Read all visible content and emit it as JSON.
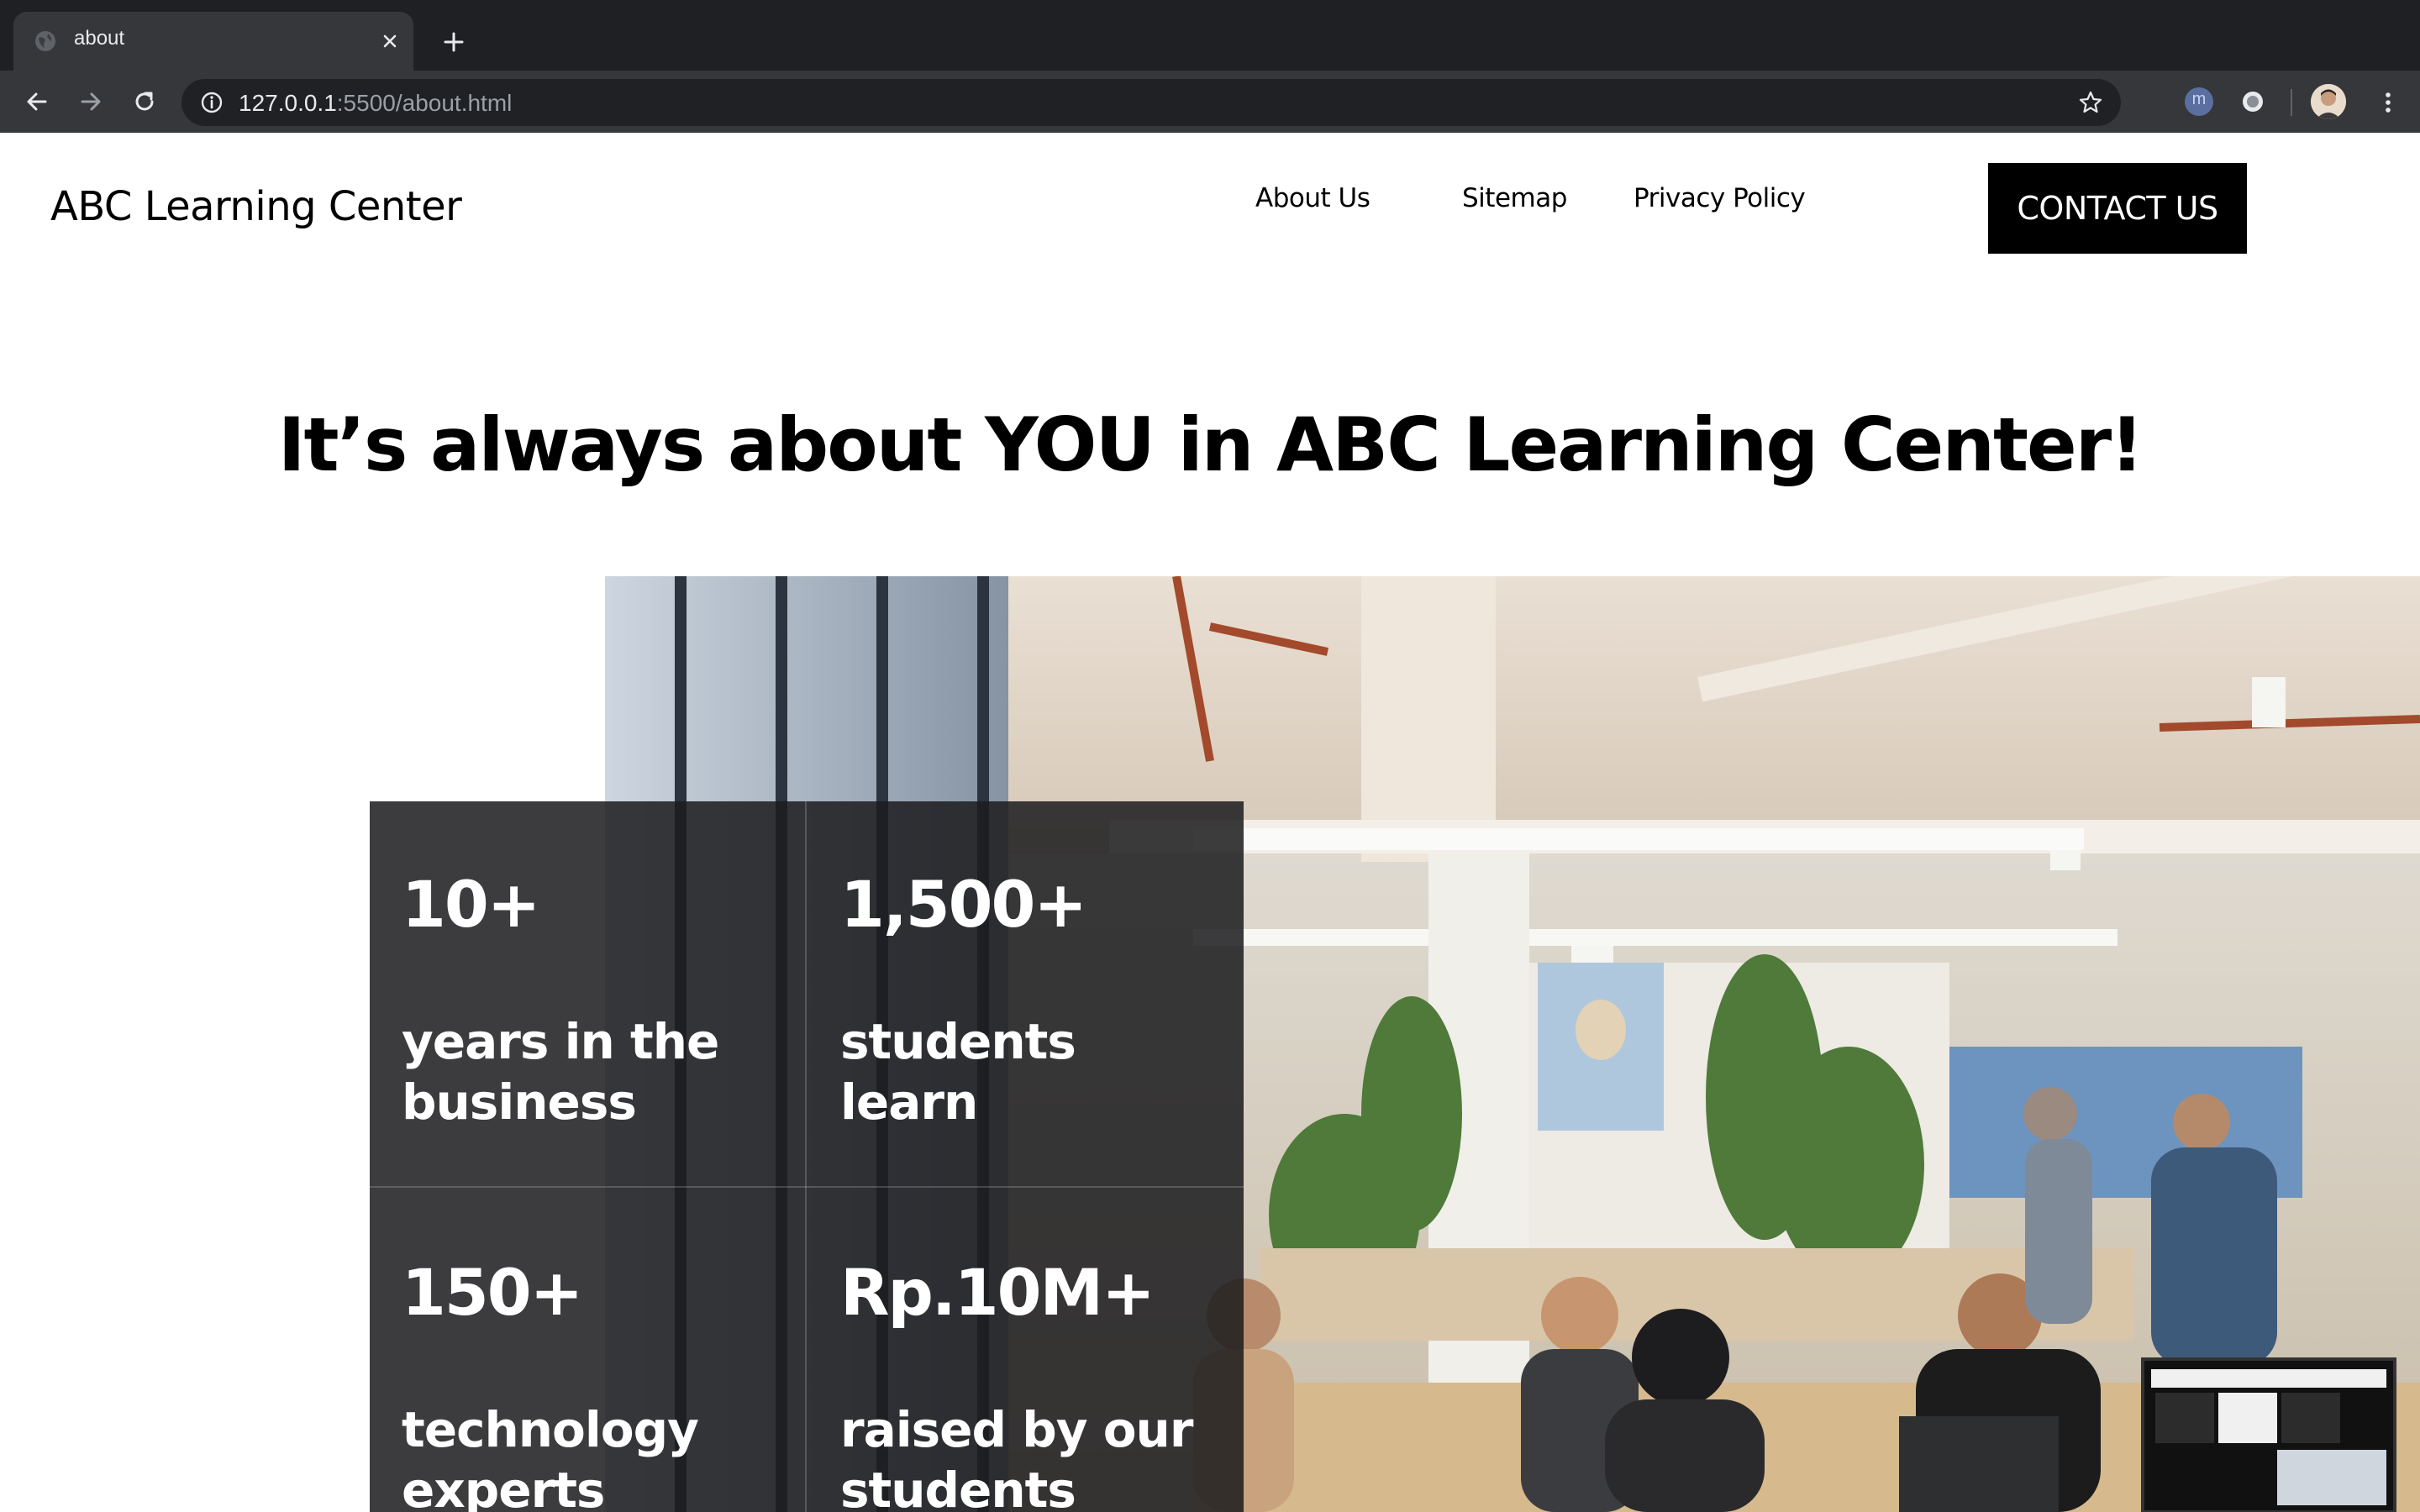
{
  "browser": {
    "tab": {
      "title": "about"
    },
    "url": {
      "host": "127.0.0.1",
      "rest": ":5500/about.html"
    }
  },
  "site": {
    "logo": "ABC Learning Center",
    "nav": [
      "About Us",
      "Sitemap",
      "Privacy Policy"
    ],
    "cta": "CONTACT US"
  },
  "hero": {
    "headline": "It’s always about YOU in ABC Learning Center!"
  },
  "stats": [
    {
      "value": "10+",
      "label": "years in the business"
    },
    {
      "value": "1,500+",
      "label": "students learn"
    },
    {
      "value": "150+",
      "label": "technology experts"
    },
    {
      "value": "Rp.10M+",
      "label": "raised by our students"
    }
  ],
  "colors": {
    "chrome_dark": "#1f2023",
    "chrome_toolbar": "#36373a",
    "cta_bg": "#000000",
    "stats_overlay": "#1c1c1e"
  }
}
